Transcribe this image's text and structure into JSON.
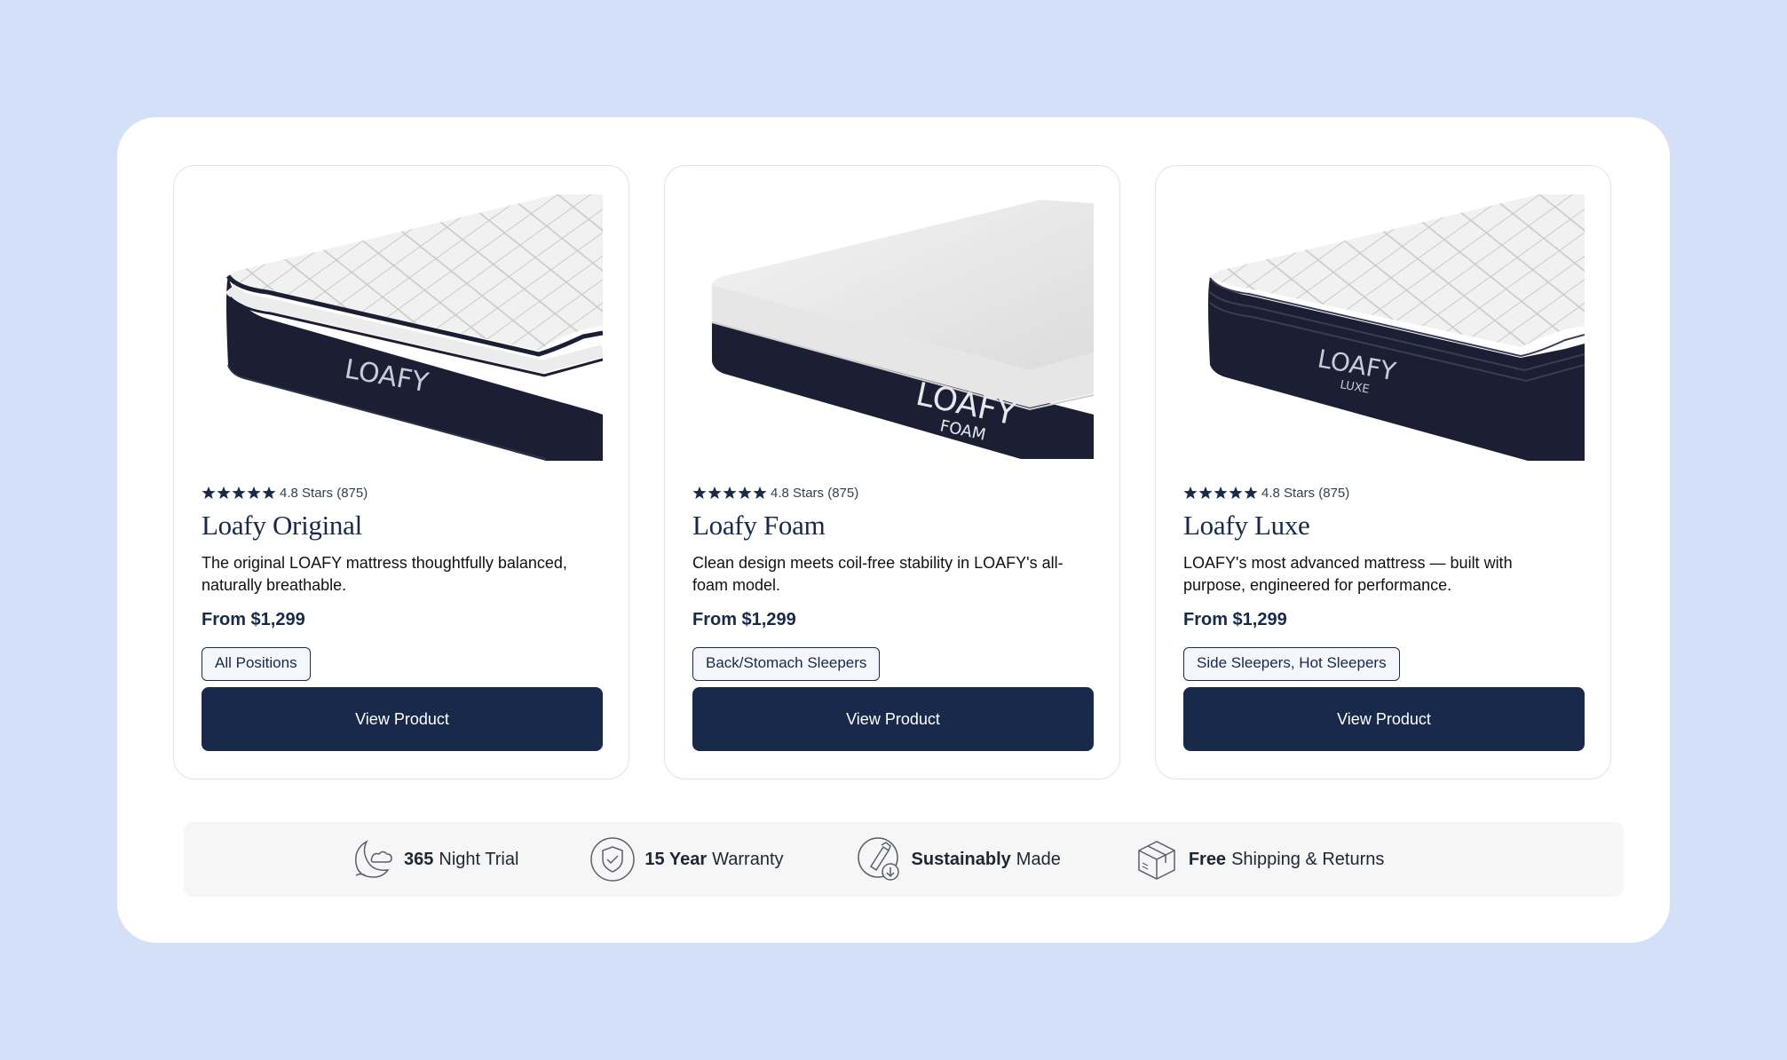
{
  "products": [
    {
      "rating_text": "4.8 Stars (875)",
      "name": "Loafy Original",
      "description": "The original LOAFY mattress  thoughtfully balanced, naturally breathable.",
      "price": "From $1,299",
      "tag": "All Positions",
      "button": "View Product",
      "brand_label": "LOAFY",
      "sub_label": ""
    },
    {
      "rating_text": "4.8 Stars (875)",
      "name": "Loafy Foam",
      "description": "Clean design meets coil-free stability in LOAFY's all-foam model.",
      "price": "From $1,299",
      "tag": "Back/Stomach Sleepers",
      "button": "View Product",
      "brand_label": "LOAFY",
      "sub_label": "FOAM"
    },
    {
      "rating_text": "4.8 Stars (875)",
      "name": "Loafy Luxe",
      "description": "LOAFY's most advanced mattress — built with purpose, engineered for performance.",
      "price": "From $1,299",
      "tag": "Side Sleepers, Hot Sleepers",
      "button": "View Product",
      "brand_label": "LOAFY",
      "sub_label": "LUXE"
    }
  ],
  "features": [
    {
      "bold": "365",
      "rest": "Night Trial",
      "icon": "moon-cloud-icon"
    },
    {
      "bold": "15 Year",
      "rest": "Warranty",
      "icon": "shield-check-icon"
    },
    {
      "bold": "Sustainably",
      "rest": "Made",
      "icon": "eco-bottle-icon"
    },
    {
      "bold": "Free",
      "rest": "Shipping & Returns",
      "icon": "package-box-icon"
    }
  ],
  "colors": {
    "page_background": "#d3e0f8",
    "navy": "#18294a",
    "feature_strip": "#f6f6f6"
  }
}
